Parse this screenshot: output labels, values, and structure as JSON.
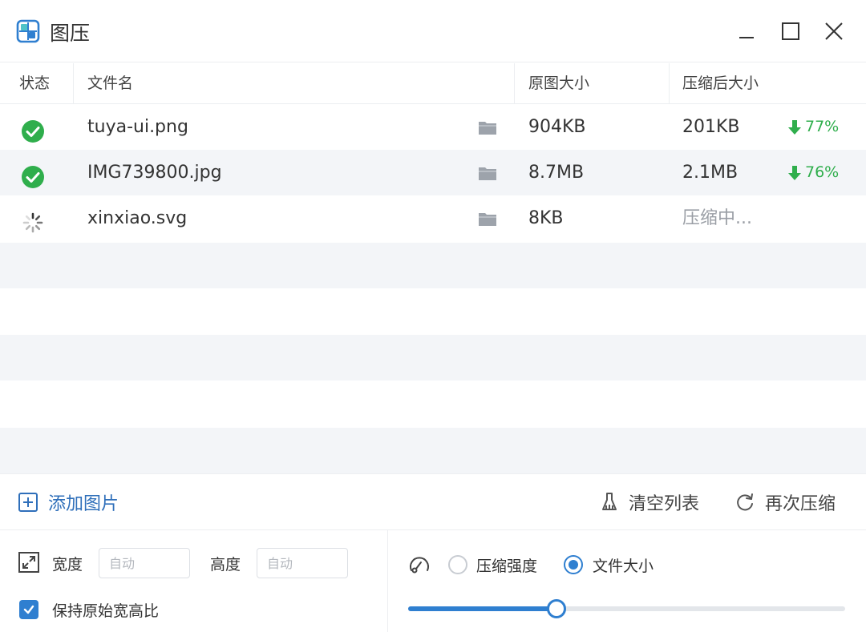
{
  "window": {
    "title": "图压",
    "icon": "app-logo-icon"
  },
  "table": {
    "columns": {
      "status": "状态",
      "filename": "文件名",
      "original_size": "原图大小",
      "compressed_size": "压缩后大小"
    },
    "rows": [
      {
        "status": "done",
        "filename": "tuya-ui.png",
        "original_size": "904KB",
        "compressed_size": "201KB",
        "saving": "77%"
      },
      {
        "status": "done",
        "filename": "IMG739800.jpg",
        "original_size": "8.7MB",
        "compressed_size": "2.1MB",
        "saving": "76%"
      },
      {
        "status": "compressing",
        "filename": "xinxiao.svg",
        "original_size": "8KB",
        "compressed_size": "压缩中...",
        "saving": ""
      }
    ]
  },
  "actions": {
    "add_images": "添加图片",
    "clear_list": "清空列表",
    "recompress": "再次压缩"
  },
  "settings": {
    "width_label": "宽度",
    "width_placeholder": "自动",
    "height_label": "高度",
    "height_placeholder": "自动",
    "keep_ratio_label": "保持原始宽高比",
    "keep_ratio_checked": true,
    "mode_options": [
      "压缩强度",
      "文件大小"
    ],
    "mode_selected": "文件大小",
    "slider_level": 0.34
  },
  "colors": {
    "accent": "#2f7fd0",
    "success": "#2fae4c",
    "stripe": "#f3f5f8",
    "muted": "#9a9ea5"
  }
}
